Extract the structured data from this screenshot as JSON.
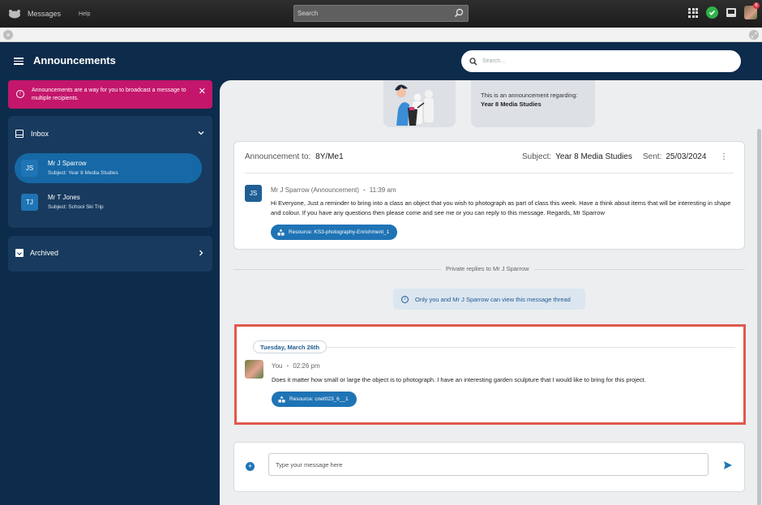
{
  "topbar": {
    "app_name": "Messages",
    "help": "Help",
    "search_placeholder": "Search",
    "notification_count": "6"
  },
  "header": {
    "title": "Announcements",
    "search_placeholder": "Search..."
  },
  "sidebar": {
    "alert": "Announcements are a way for you to broadcast a message to multiple recipients.",
    "inbox_label": "Inbox",
    "items": [
      {
        "initials": "JS",
        "name": "Mr J Sparrow",
        "subject": "Subject: Year 8 Media Studies"
      },
      {
        "initials": "TJ",
        "name": "Mr T Jones",
        "subject": "Subject: School Ski Trip"
      }
    ],
    "archived_label": "Archived"
  },
  "regarding": {
    "line1": "This is an announcement regarding:",
    "line2": "Year 8 Media Studies"
  },
  "announcement": {
    "to_label": "Announcement to:",
    "to_value": "8Y/Me1",
    "subject_label": "Subject:",
    "subject_value": "Year 8 Media Studies",
    "sent_label": "Sent:",
    "sent_value": "25/03/2024",
    "sender_initials": "JS",
    "sender": "Mr J Sparrow (Announcement)",
    "time": "11:39 am",
    "body": "Hi Everyone, Just a reminder to bring into a class an object that you wish to photograph as part of class this week. Have a think about items that will be interesting in shape and colour. If you have any questions then please come and see me or you can reply to this message. Regards, Mr Sparrow",
    "resource": "Resource: KS3-photography-Enrichment_1"
  },
  "private": {
    "label": "Private replies to Mr J Sparrow",
    "notice": "Only you and Mr J Sparrow can view this message thread"
  },
  "reply": {
    "date": "Tuesday, March 26th",
    "author": "You",
    "time": "02:26 pm",
    "body": "Does it matter how small or large the object is to photograph. I have an interesting garden sculpture that I would like to bring for this project.",
    "resource": "Resource: cnet023_6__1"
  },
  "compose": {
    "placeholder": "Type your message here"
  }
}
